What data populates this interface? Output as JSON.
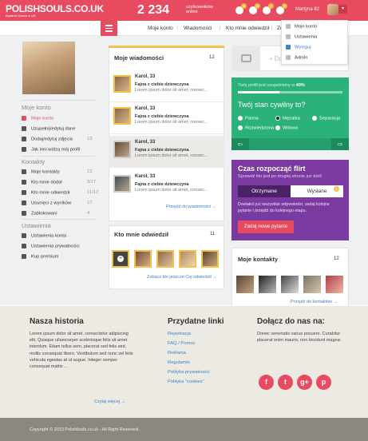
{
  "brand": {
    "logo_text": "POLISHSOULS.CO.UK",
    "tagline": "Brytania Dusza w UK"
  },
  "header": {
    "online_count": "2 234",
    "online_label_1": "użytkowników",
    "online_label_2": "online",
    "badges": [
      "5",
      "12",
      "2",
      "5"
    ],
    "user_name": "Martyna 82"
  },
  "nav": {
    "items": [
      "Moje konto",
      "Wiadomości",
      "Kto mnie odwiedził",
      "Zdj"
    ]
  },
  "dropdown": {
    "items": [
      "Moje konto",
      "Ustawienia",
      "Wyloguj",
      "Admin"
    ]
  },
  "sidebar": {
    "sections": [
      {
        "title": "Moje konto",
        "items": [
          {
            "label": "Moje konto",
            "count": "",
            "active": true
          },
          {
            "label": "Uzupełnij/edytuj dane",
            "count": ""
          },
          {
            "label": "Dodaj/edytuj zdjęcia",
            "count": "13"
          },
          {
            "label": "Jak inni widzą mój profil",
            "count": ""
          }
        ]
      },
      {
        "title": "Kontakty",
        "items": [
          {
            "label": "Moje kontakty",
            "count": "12"
          },
          {
            "label": "Kto mnie dodał",
            "count": "3/17"
          },
          {
            "label": "Kto mnie odwiedził",
            "count": "11/12"
          },
          {
            "label": "Usunięci z wyników",
            "count": "17"
          },
          {
            "label": "Zablokowani",
            "count": "4"
          }
        ]
      },
      {
        "title": "Ustawienia",
        "items": [
          {
            "label": "Ustawienia konta",
            "count": ""
          },
          {
            "label": "Ustawienia prywatności",
            "count": ""
          },
          {
            "label": "Kup premium",
            "count": ""
          }
        ]
      }
    ]
  },
  "messages": {
    "title": "Moje wiadomości",
    "count": "12",
    "items": [
      {
        "name": "Karol, 33",
        "subject": "Fajna z ciebie dziewczyna",
        "body": "Lorem ipsum dolor sit amet, consec..."
      },
      {
        "name": "Karol, 33",
        "subject": "Fajna z ciebie dziewczyna",
        "body": "Lorem ipsum dolor sit amet, consec..."
      },
      {
        "name": "Karol, 33",
        "subject": "Fajna z ciebie dziewczyna",
        "body": "Lorem ipsum dolor sit amet, consec..."
      },
      {
        "name": "Karol, 33",
        "subject": "Fajna z ciebie dziewczyna",
        "body": "Lorem ipsum dolor sit amet, consec..."
      }
    ],
    "more_link": "Przejdź do wiadomości"
  },
  "visitors": {
    "title": "Kto mnie odwiedził",
    "count": "11",
    "more_link": "Zobacz kto jeszcze Cię odwiedził"
  },
  "photo_panel": {
    "add_label": "+ Dodaj"
  },
  "profile_status": {
    "progress_text": "Twój profil jest uzupełniony w",
    "progress_value": "40%",
    "progress": 0.4,
    "question": "Twój stan cywilny to?",
    "options": [
      "Panna",
      "Mężatka",
      "Separacja",
      "Rozwiedziona",
      "Wdowa"
    ],
    "selected": "Mężatka"
  },
  "flirt": {
    "title": "Czas rozpocząć flirt",
    "subtitle": "Sprawdź kto jest po drugiej stronie już dziś!",
    "tab_received": "Otrzymane",
    "tab_sent": "Wysłane",
    "tab_badge": "1",
    "desc": "Dostałeś już wszystkie odpowiedzi, zadaj kolejne pytanie i przejdź do kolejnego etapu.",
    "button": "Zadaj nowe pytanie"
  },
  "contacts": {
    "title": "Moje kontakty",
    "count": "12",
    "more_link": "Przejdź do kontaktów"
  },
  "footer": {
    "history_title": "Nasza historia",
    "history_text": "Lorem ipsum dolor sit amet, consectetur adipiscing elit. Quisque ullamcorper scelerisque felis sit amet interdum. Etiam tellus sem, placerat sed felis sed, mollis consequat libero. Vestibulum sed nunc vel felis vehicula egestas at ut augue. Integer semper consequat mattis ...",
    "read_more": "Czytaj więcej",
    "links_title": "Przydatne linki",
    "links": [
      "Rejestracja",
      "FAQ / Pomoc",
      "Reklama",
      "Regulamin",
      "Polityka prywatności",
      "Polityka \"cookies\""
    ],
    "join_title": "Dołącz do nas na:",
    "join_text": "Donec venenatis varius posuere. Curabitur placerat enim mauris, non tincidunt magna:",
    "social": [
      "f",
      "t",
      "g+",
      "p"
    ],
    "copyright": "Copyright © 2013 Polishbuds.co.uk - All Right Reserved."
  },
  "colors": {
    "accent": "#e84a5f",
    "green": "#2bb27a",
    "purple": "#7a3aa0",
    "gold": "#f1c24b",
    "link": "#3a83c7"
  }
}
